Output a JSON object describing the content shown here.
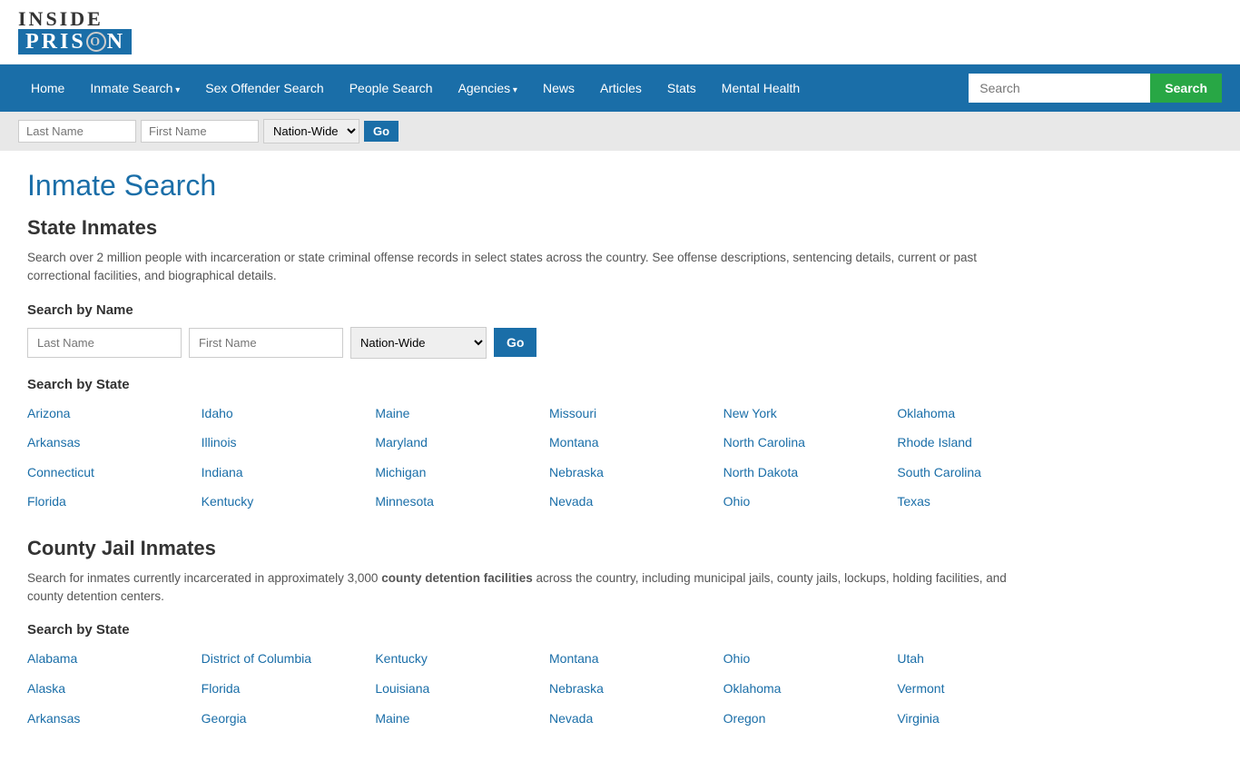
{
  "logo": {
    "inside": "INSIDE",
    "prison": "PRISⓄN"
  },
  "nav": {
    "items": [
      {
        "label": "Home",
        "dropdown": false
      },
      {
        "label": "Inmate Search",
        "dropdown": true
      },
      {
        "label": "Sex Offender Search",
        "dropdown": false
      },
      {
        "label": "People Search",
        "dropdown": false
      },
      {
        "label": "Agencies",
        "dropdown": true
      },
      {
        "label": "News",
        "dropdown": false
      },
      {
        "label": "Articles",
        "dropdown": false
      },
      {
        "label": "Stats",
        "dropdown": false
      },
      {
        "label": "Mental Health",
        "dropdown": false
      }
    ],
    "search_placeholder": "Search",
    "search_button": "Search"
  },
  "quick_search": {
    "last_name_placeholder": "Last Name",
    "first_name_placeholder": "First Name",
    "dropdown_default": "Nation-Wide",
    "go_button": "Go"
  },
  "page": {
    "title": "Inmate Search",
    "section1_title": "State Inmates",
    "section1_desc": "Search over 2 million people with incarceration or state criminal offense records in select states across the country. See offense descriptions, sentencing details, current or past correctional facilities, and biographical details.",
    "search_by_name": "Search by Name",
    "last_name_placeholder": "Last Name",
    "first_name_placeholder": "First Name",
    "dropdown_default": "Nation-Wide",
    "go_button": "Go",
    "search_by_state": "Search by State",
    "state_inmates": [
      [
        "Arizona",
        "Idaho",
        "Maine",
        "Missouri",
        "New York",
        "Oklahoma"
      ],
      [
        "Arkansas",
        "Illinois",
        "Maryland",
        "Montana",
        "North Carolina",
        "Rhode Island"
      ],
      [
        "Connecticut",
        "Indiana",
        "Michigan",
        "Nebraska",
        "North Dakota",
        "South Carolina"
      ],
      [
        "Florida",
        "Kentucky",
        "Minnesota",
        "Nevada",
        "Ohio",
        "Texas"
      ]
    ],
    "section2_title": "County Jail Inmates",
    "section2_desc1": "Search for inmates currently incarcerated in approximately 3,000 ",
    "section2_bold": "county detention facilities",
    "section2_desc2": " across the country, including municipal jails, county jails, lockups, holding facilities, and county detention centers.",
    "search_by_state2": "Search by State",
    "county_inmates": [
      [
        "Alabama",
        "District of Columbia",
        "Kentucky",
        "Montana",
        "Ohio",
        "Utah"
      ],
      [
        "Alaska",
        "Florida",
        "Louisiana",
        "Nebraska",
        "Oklahoma",
        "Vermont"
      ],
      [
        "Arkansas",
        "Georgia",
        "Maine",
        "Nevada",
        "Oregon",
        "Virginia"
      ]
    ]
  }
}
